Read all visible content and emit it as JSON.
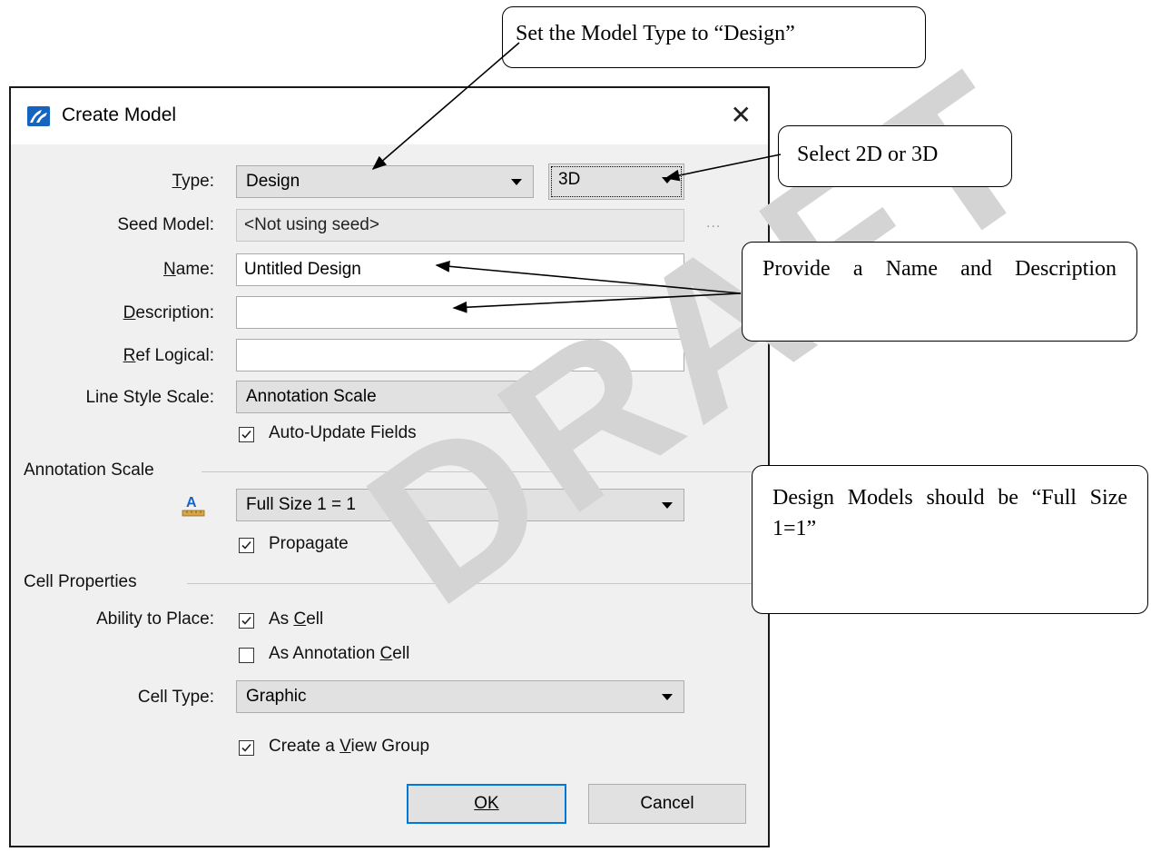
{
  "dialog": {
    "title": "Create Model",
    "fields": {
      "type": {
        "label": "Type:",
        "value": "Design",
        "dim": "3D"
      },
      "seed_model": {
        "label": "Seed Model:",
        "value": "<Not using seed>",
        "browse": "..."
      },
      "name": {
        "label": "Name:",
        "value": "Untitled Design"
      },
      "description": {
        "label": "Description:",
        "value": ""
      },
      "ref_logical": {
        "label": "Ref Logical:",
        "value": ""
      },
      "line_style_scale": {
        "label": "Line Style Scale:",
        "value": "Annotation Scale"
      },
      "auto_update": {
        "label": "Auto-Update Fields",
        "checked": true
      }
    },
    "annotation_scale": {
      "section": "Annotation Scale",
      "value": "Full Size 1 = 1",
      "propagate": {
        "label": "Propagate",
        "checked": true
      }
    },
    "cell_properties": {
      "section": "Cell Properties",
      "ability_label": "Ability to Place:",
      "as_cell": {
        "label": "As Cell",
        "checked": true
      },
      "as_annotation_cell": {
        "label": "As Annotation Cell",
        "checked": false
      },
      "cell_type": {
        "label": "Cell Type:",
        "value": "Graphic"
      },
      "view_group": {
        "label": "Create a View Group",
        "checked": true
      }
    },
    "buttons": {
      "ok": "OK",
      "cancel": "Cancel"
    }
  },
  "callouts": {
    "model_type": "Set the Model Type to “Design”",
    "dimension": "Select 2D or 3D",
    "name_desc": "Provide a Name and Description",
    "design_models": "Design Models should be “Full Size 1=1”"
  },
  "watermark": "DRAFT",
  "colors": {
    "default_button_border": "#0078d7",
    "icon_blue": "#1565c0"
  }
}
